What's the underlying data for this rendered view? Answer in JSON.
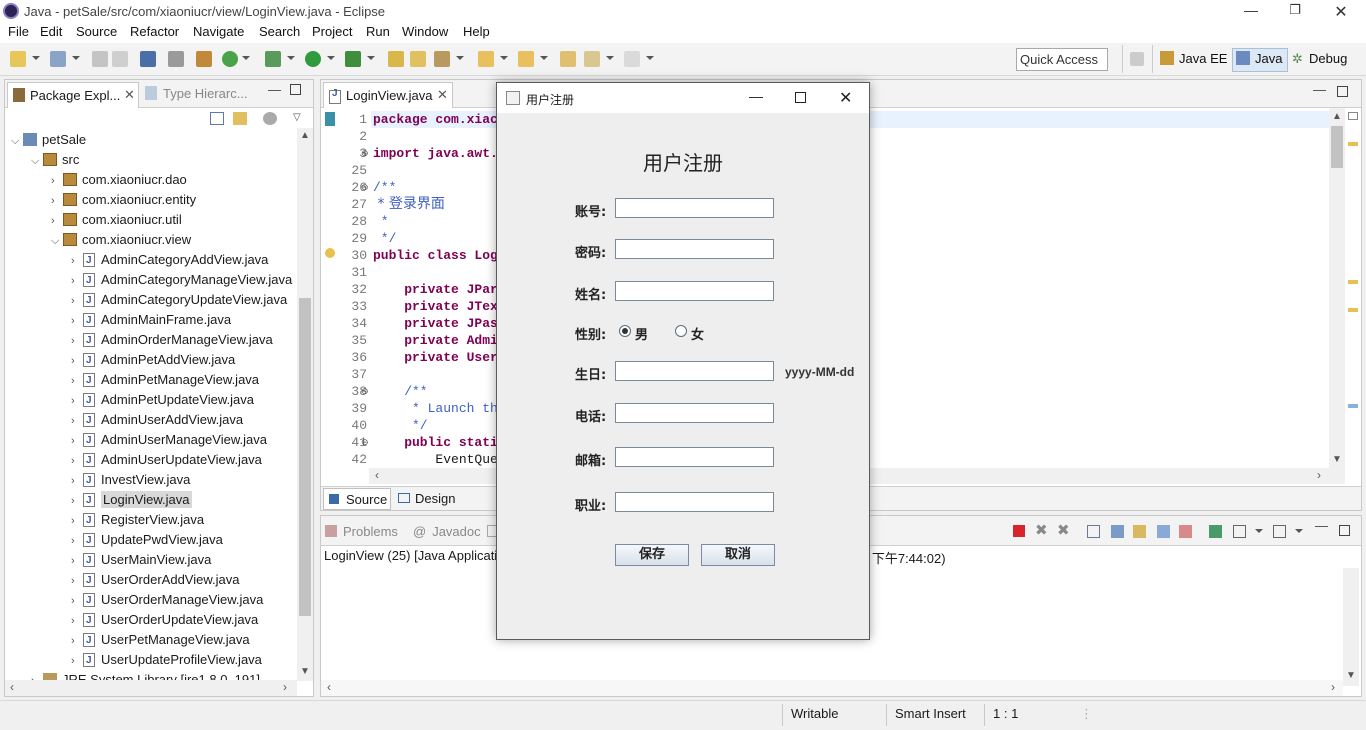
{
  "window": {
    "title": "Java - petSale/src/com/xiaoniucr/view/LoginView.java - Eclipse"
  },
  "menu": [
    "File",
    "Edit",
    "Source",
    "Refactor",
    "Navigate",
    "Search",
    "Project",
    "Run",
    "Window",
    "Help"
  ],
  "quick_access": "Quick Access",
  "perspectives": [
    "Java EE",
    "Java",
    "Debug"
  ],
  "explorer": {
    "tab_package": "Package Expl...",
    "tab_type": "Type Hierarc...",
    "project": "petSale",
    "src": "src",
    "packages": [
      "com.xiaoniucr.dao",
      "com.xiaoniucr.entity",
      "com.xiaoniucr.util",
      "com.xiaoniucr.view"
    ],
    "files": [
      "AdminCategoryAddView.java",
      "AdminCategoryManageView.java",
      "AdminCategoryUpdateView.java",
      "AdminMainFrame.java",
      "AdminOrderManageView.java",
      "AdminPetAddView.java",
      "AdminPetManageView.java",
      "AdminPetUpdateView.java",
      "AdminUserAddView.java",
      "AdminUserManageView.java",
      "AdminUserUpdateView.java",
      "InvestView.java",
      "LoginView.java",
      "RegisterView.java",
      "UpdatePwdView.java",
      "UserMainView.java",
      "UserOrderAddView.java",
      "UserOrderManageView.java",
      "UserOrderUpdateView.java",
      "UserPetManageView.java",
      "UserUpdateProfileView.java"
    ],
    "jre": "JRE System Library [jre1.8.0_191]"
  },
  "editor": {
    "tab": "LoginView.java",
    "lines": [
      {
        "n": "1",
        "t": "package com.xiac"
      },
      {
        "n": "2",
        "t": ""
      },
      {
        "n": "3",
        "t": "import java.awt."
      },
      {
        "n": "25",
        "t": ""
      },
      {
        "n": "26",
        "t": "/**"
      },
      {
        "n": "27",
        "t": " * 登录界面"
      },
      {
        "n": "28",
        "t": " *"
      },
      {
        "n": "29",
        "t": " */"
      },
      {
        "n": "30",
        "t": "public class Log"
      },
      {
        "n": "31",
        "t": ""
      },
      {
        "n": "32",
        "t": "    private JPar"
      },
      {
        "n": "33",
        "t": "    private JTex"
      },
      {
        "n": "34",
        "t": "    private JPas"
      },
      {
        "n": "35",
        "t": "    private Admi"
      },
      {
        "n": "36",
        "t": "    private User"
      },
      {
        "n": "37",
        "t": ""
      },
      {
        "n": "38",
        "t": "    /**"
      },
      {
        "n": "39",
        "t": "     * Launch th"
      },
      {
        "n": "40",
        "t": "     */"
      },
      {
        "n": "41",
        "t": "    public stati"
      },
      {
        "n": "42",
        "t": "        EventQue"
      }
    ],
    "source_tab": "Source",
    "design_tab": "Design"
  },
  "console": {
    "tab_problems": "Problems",
    "tab_javadoc": "Javadoc",
    "text_left": "LoginView (25) [Java Applicatio",
    "text_right": "6日 下午7:44:02)"
  },
  "dialog": {
    "title": "用户注册",
    "heading": "用户注册",
    "labels": {
      "account": "账号:",
      "password": "密码:",
      "name": "姓名:",
      "gender": "性别:",
      "birthday": "生日:",
      "phone": "电话:",
      "email": "邮箱:",
      "job": "职业:"
    },
    "gender_options": [
      "男",
      "女"
    ],
    "date_hint": "yyyy-MM-dd",
    "save": "保存",
    "cancel": "取消"
  },
  "statusbar": {
    "writable": "Writable",
    "insert": "Smart Insert",
    "position": "1 : 1"
  }
}
